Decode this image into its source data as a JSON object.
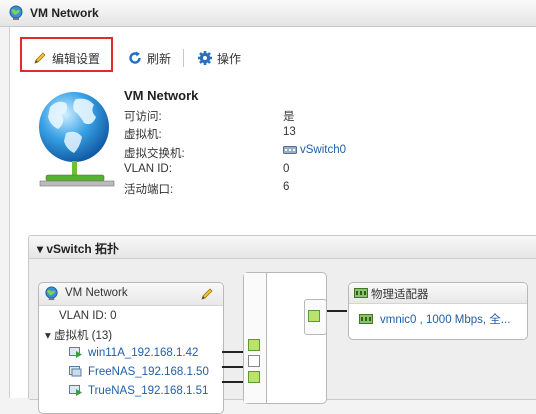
{
  "window": {
    "title": "VM Network"
  },
  "toolbar": {
    "edit_label": "编辑设置",
    "refresh_label": "刷新",
    "actions_label": "操作"
  },
  "summary": {
    "name": "VM Network",
    "rows": [
      {
        "key": "可访问:",
        "value": "是",
        "is_link": false
      },
      {
        "key": "虚拟机:",
        "value": "13",
        "is_link": false
      },
      {
        "key": "虚拟交换机:",
        "value": "vSwitch0",
        "is_link": true
      },
      {
        "key": "VLAN ID:",
        "value": "0",
        "is_link": false
      },
      {
        "key": "活动端口:",
        "value": "6",
        "is_link": false
      }
    ]
  },
  "topology": {
    "header": "vSwitch 拓扑",
    "portgroup": {
      "name": "VM Network",
      "vlan": "VLAN ID: 0",
      "vm_group_label": "虚拟机 (13)",
      "vms": [
        {
          "name": "win11A_192.168.1.42",
          "powered_on": true
        },
        {
          "name": "FreeNAS_192.168.1.50",
          "powered_on": false
        },
        {
          "name": "TrueNAS_192.168.1.51",
          "powered_on": true
        }
      ]
    },
    "adapters": {
      "header": "物理适配器",
      "nic": "vmnic0 , 1000 Mbps, 全..."
    }
  },
  "colors": {
    "highlight": "#e02b2b",
    "link": "#1f5fa8",
    "port_active": "#b9e36a"
  }
}
